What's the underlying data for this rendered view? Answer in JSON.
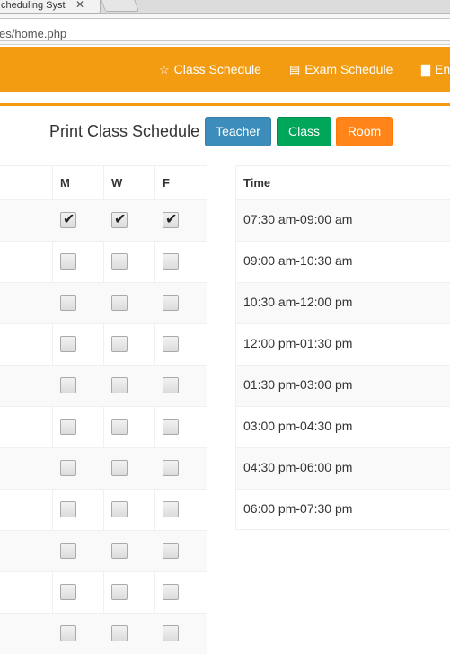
{
  "browser": {
    "tab_title": "cheduling Syst",
    "url": "es/home.php"
  },
  "nav": {
    "items": [
      {
        "icon": "star-icon",
        "label": "Class Schedule"
      },
      {
        "icon": "list-icon",
        "label": "Exam Schedule"
      },
      {
        "icon": "file-icon",
        "label": "En"
      }
    ]
  },
  "print": {
    "title": "Print Class Schedule",
    "teacher_label": "Teacher",
    "class_label": "Class",
    "room_label": "Room"
  },
  "days": {
    "headers": [
      "M",
      "W",
      "F"
    ],
    "rows": [
      [
        true,
        true,
        true
      ],
      [
        false,
        false,
        false
      ],
      [
        false,
        false,
        false
      ],
      [
        false,
        false,
        false
      ],
      [
        false,
        false,
        false
      ],
      [
        false,
        false,
        false
      ],
      [
        false,
        false,
        false
      ],
      [
        false,
        false,
        false
      ],
      [
        false,
        false,
        false
      ],
      [
        false,
        false,
        false
      ],
      [
        false,
        false,
        false
      ]
    ]
  },
  "times": {
    "header": "Time",
    "slots": [
      "07:30 am-09:00 am",
      "09:00 am-10:30 am",
      "10:30 am-12:00 pm",
      "12:00 pm-01:30 pm",
      "01:30 pm-03:00 pm",
      "03:00 pm-04:30 pm",
      "04:30 pm-06:00 pm",
      "06:00 pm-07:30 pm"
    ]
  },
  "colors": {
    "navbar": "#f39c12",
    "teacher": "#3c8dbc",
    "class": "#00a65a",
    "room": "#ff851b"
  }
}
